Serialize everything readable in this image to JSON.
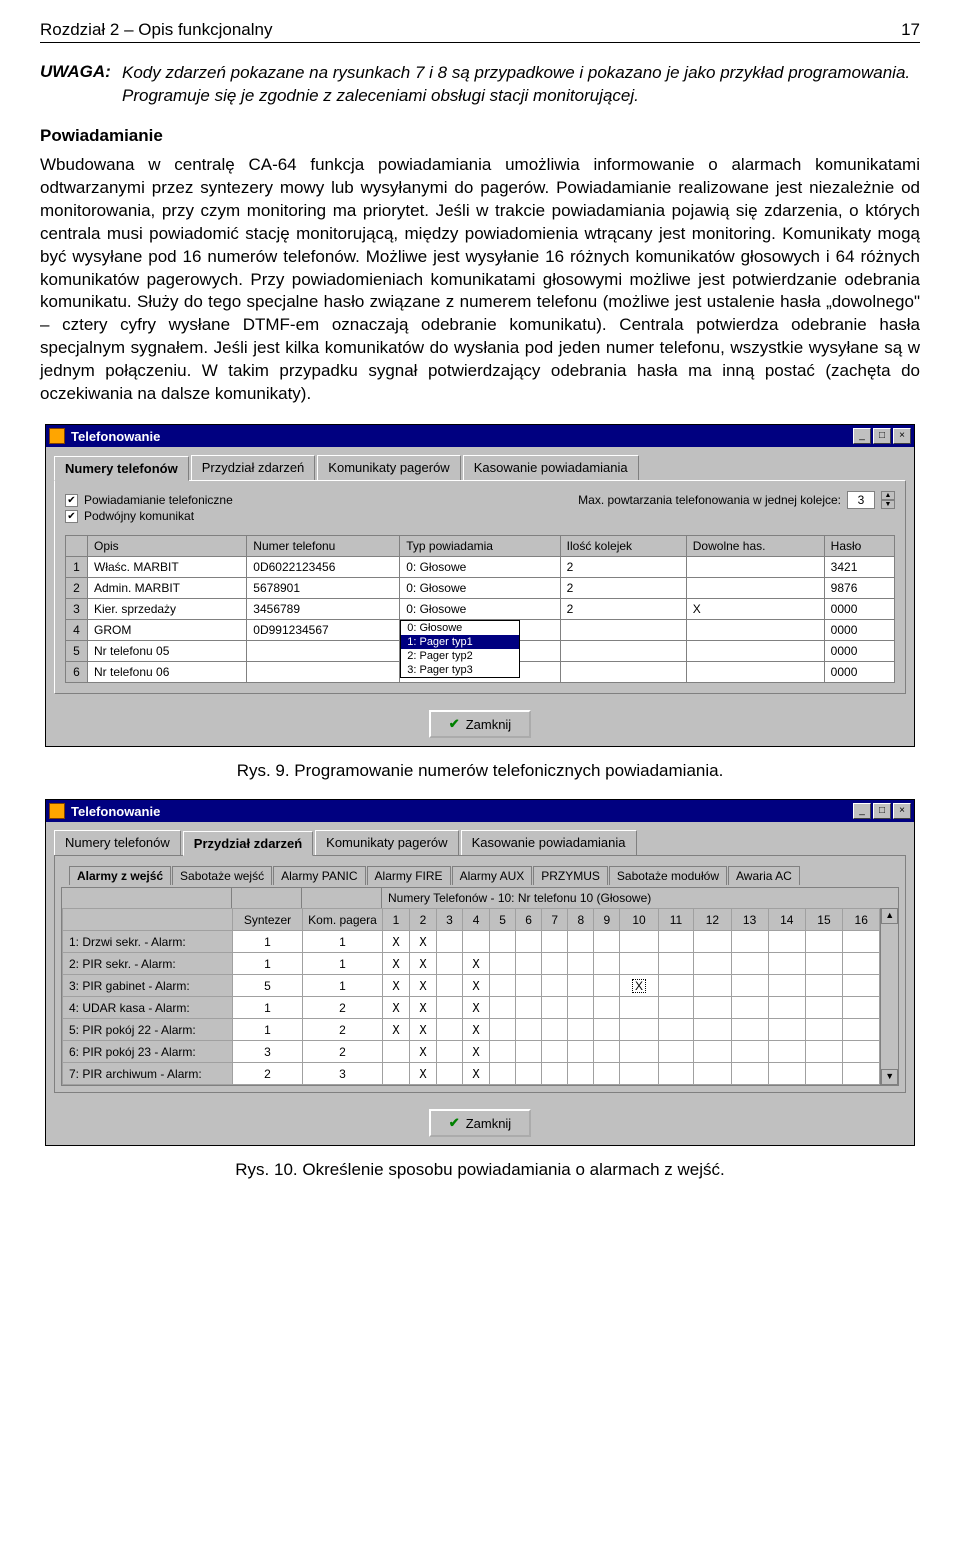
{
  "header": {
    "left": "Rozdział 2 – Opis funkcjonalny",
    "right": "17"
  },
  "uwaga": {
    "label": "UWAGA:",
    "text": "Kody zdarzeń pokazane na rysunkach 7 i 8 są przypadkowe i pokazano je jako przykład programowania. Programuje się je zgodnie z zaleceniami obsługi stacji monitorującej."
  },
  "section_title": "Powiadamianie",
  "paragraph": "Wbudowana w centralę CA-64 funkcja powiadamiania umożliwia informowanie o alarmach komunikatami odtwarzanymi przez syntezery mowy lub wysyłanymi do pagerów. Powiadamianie realizowane jest niezależnie od monitorowania, przy czym monitoring ma priorytet. Jeśli w trakcie powiadamiania pojawią się zdarzenia, o których centrala musi powiadomić stację monitorującą, między powiadomienia wtrącany jest monitoring. Komunikaty mogą być wysyłane pod 16 numerów telefonów. Możliwe jest wysyłanie 16 różnych komunikatów głosowych i 64 różnych komunikatów pagerowych. Przy powiadomieniach komunikatami głosowymi możliwe jest potwierdzanie odebrania komunikatu. Służy do tego specjalne hasło związane z numerem telefonu (możliwe jest ustalenie hasła „dowolnego\" – cztery cyfry wysłane DTMF-em oznaczają odebranie komunikatu). Centrala potwierdza odebranie hasła specjalnym sygnałem. Jeśli jest kilka komunikatów do wysłania pod jeden numer telefonu, wszystkie wysyłane są w jednym połączeniu. W takim przypadku sygnał potwierdzający odebrania hasła ma inną postać (zachęta do oczekiwania na dalsze komunikaty).",
  "fig9_caption": "Rys. 9. Programowanie numerów telefonicznych powiadamiania.",
  "fig10_caption": "Rys. 10. Określenie sposobu powiadamiania o alarmach z wejść.",
  "win1": {
    "title": "Telefonowanie",
    "tabs": [
      "Numery telefonów",
      "Przydział zdarzeń",
      "Komunikaty pagerów",
      "Kasowanie powiadamiania"
    ],
    "active_tab": 0,
    "chk1": "Powiadamianie telefoniczne",
    "chk2": "Podwójny komunikat",
    "maxrep_label": "Max. powtarzania telefonowania w jednej kolejce:",
    "maxrep_value": "3",
    "columns": [
      "Opis",
      "Numer telefonu",
      "Typ powiadamia",
      "Ilość kolejek",
      "Dowolne has.",
      "Hasło"
    ],
    "rows": [
      {
        "n": "1",
        "opis": "Właśc. MARBIT",
        "num": "0D6022123456",
        "typ": "0: Głosowe",
        "kol": "2",
        "dow": "",
        "has": "3421"
      },
      {
        "n": "2",
        "opis": "Admin. MARBIT",
        "num": "5678901",
        "typ": "0: Głosowe",
        "kol": "2",
        "dow": "",
        "has": "9876"
      },
      {
        "n": "3",
        "opis": "Kier. sprzedaży",
        "num": "3456789",
        "typ": "0: Głosowe",
        "kol": "2",
        "dow": "X",
        "has": "0000"
      },
      {
        "n": "4",
        "opis": "GROM",
        "num": "0D991234567",
        "typ": "__DROPDOWN__",
        "kol": "",
        "dow": "",
        "has": "0000"
      },
      {
        "n": "5",
        "opis": "Nr telefonu 05",
        "num": "",
        "typ": "",
        "kol": "",
        "dow": "",
        "has": "0000"
      },
      {
        "n": "6",
        "opis": "Nr telefonu 06",
        "num": "",
        "typ": "",
        "kol": "",
        "dow": "",
        "has": "0000"
      }
    ],
    "dropdown": [
      "0: Głosowe",
      "1: Pager typ1",
      "2: Pager typ2",
      "3: Pager typ3"
    ],
    "dropdown_selected": 1,
    "close_btn": "Zamknij"
  },
  "win2": {
    "title": "Telefonowanie",
    "tabs": [
      "Numery telefonów",
      "Przydział zdarzeń",
      "Komunikaty pagerów",
      "Kasowanie powiadamiania"
    ],
    "active_tab": 1,
    "subtabs": [
      "Alarmy z wejść",
      "Sabotaże wejść",
      "Alarmy PANIC",
      "Alarmy FIRE",
      "Alarmy AUX",
      "PRZYMUS",
      "Sabotaże modułów",
      "Awaria AC"
    ],
    "active_subtab": 0,
    "nt_title": "Numery Telefonów - 10: Nr telefonu 10  (Głosowe)",
    "col_syntezer": "Syntezer",
    "col_pager": "Kom. pagera",
    "num_cols": [
      "1",
      "2",
      "3",
      "4",
      "5",
      "6",
      "7",
      "8",
      "9",
      "10",
      "11",
      "12",
      "13",
      "14",
      "15",
      "16"
    ],
    "rows": [
      {
        "lbl": "1: Drzwi sekr.   - Alarm:",
        "syn": "1",
        "pag": "1",
        "marks": [
          "X",
          "X",
          "",
          "",
          "",
          "",
          "",
          "",
          "",
          "",
          "",
          "",
          "",
          "",
          "",
          ""
        ]
      },
      {
        "lbl": "2: PIR sekr.      - Alarm:",
        "syn": "1",
        "pag": "1",
        "marks": [
          "X",
          "X",
          "",
          "X",
          "",
          "",
          "",
          "",
          "",
          "",
          "",
          "",
          "",
          "",
          "",
          ""
        ]
      },
      {
        "lbl": "3: PIR gabinet  - Alarm:",
        "syn": "5",
        "pag": "1",
        "marks": [
          "X",
          "X",
          "",
          "X",
          "",
          "",
          "",
          "",
          "",
          "⊡",
          "",
          "",
          "",
          "",
          "",
          ""
        ]
      },
      {
        "lbl": "4: UDAR kasa  - Alarm:",
        "syn": "1",
        "pag": "2",
        "marks": [
          "X",
          "X",
          "",
          "X",
          "",
          "",
          "",
          "",
          "",
          "",
          "",
          "",
          "",
          "",
          "",
          ""
        ]
      },
      {
        "lbl": "5: PIR pokój 22 - Alarm:",
        "syn": "1",
        "pag": "2",
        "marks": [
          "X",
          "X",
          "",
          "X",
          "",
          "",
          "",
          "",
          "",
          "",
          "",
          "",
          "",
          "",
          "",
          ""
        ]
      },
      {
        "lbl": "6: PIR pokój 23 - Alarm:",
        "syn": "3",
        "pag": "2",
        "marks": [
          "",
          "X",
          "",
          "X",
          "",
          "",
          "",
          "",
          "",
          "",
          "",
          "",
          "",
          "",
          "",
          ""
        ]
      },
      {
        "lbl": "7: PIR archiwum - Alarm:",
        "syn": "2",
        "pag": "3",
        "marks": [
          "",
          "X",
          "",
          "X",
          "",
          "",
          "",
          "",
          "",
          "",
          "",
          "",
          "",
          "",
          "",
          ""
        ]
      }
    ],
    "close_btn": "Zamknij"
  }
}
